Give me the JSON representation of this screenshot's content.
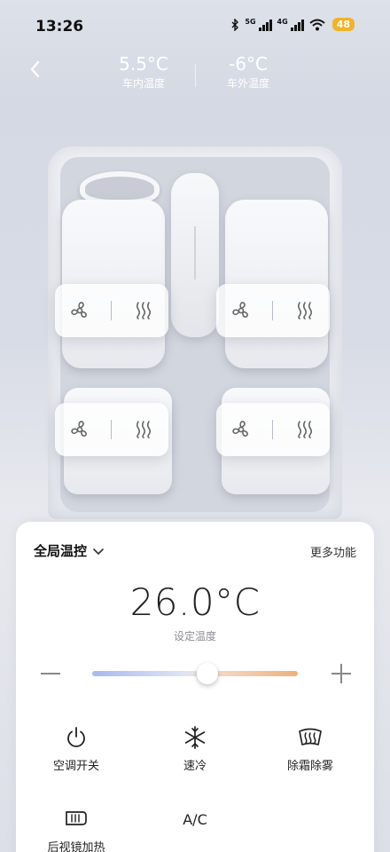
{
  "status_bar": {
    "time": "13:26",
    "net1": "5G",
    "net2": "4G",
    "battery": "48"
  },
  "header": {
    "inside_temp": "5.5°C",
    "inside_label": "车内温度",
    "outside_temp": "-6°C",
    "outside_label": "车外温度"
  },
  "seats": [
    {
      "name": "front-left"
    },
    {
      "name": "front-right"
    },
    {
      "name": "rear-left"
    },
    {
      "name": "rear-right"
    }
  ],
  "panel": {
    "mode": "全局温控",
    "more": "更多功能",
    "set_temp": "26.0°C",
    "set_temp_label": "设定温度",
    "slider_fraction": 0.56,
    "functions": [
      {
        "label": "空调开关",
        "icon": "power-icon"
      },
      {
        "label": "速冷",
        "icon": "snowflake-icon"
      },
      {
        "label": "除霜除雾",
        "icon": "defrost-icon"
      },
      {
        "label": "后视镜加热",
        "icon": "mirror-heat-icon"
      },
      {
        "label": "A/C",
        "icon": "ac-icon"
      }
    ]
  },
  "colors": {
    "accent_cool": "#a8b9ee",
    "accent_warm": "#efb07a",
    "battery": "#f0b429"
  }
}
